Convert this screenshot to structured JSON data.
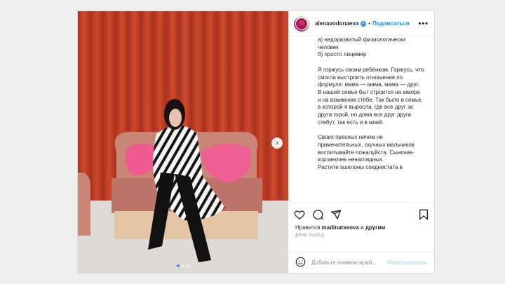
{
  "post": {
    "username": "alenavodonaeva",
    "separator": "•",
    "follow_label": "Подписаться",
    "more_label": "•••",
    "caption": "а) недоразвитый физиологически человек\nб) просто лицемер\n\nЯ горжусь своим ребёнком. Горжусь, что смогла выстроить отношения по формуле: мама — мама, мама — друг.\nВ нашей семье быт строится на юморе и на взаимном стёбе. Так было в семье, в которой я выросла, где все друг за друга горой, но дома все друг друга стебут, так есть и в моей.\n\nСвоих пресных ничем не примечательных, скучных мальчиков воспитывайте пожалуйста. Сыночек-корзиночек ненаглядных.\nРастите эшелоны соеднестата в",
    "likes_prefix": "Нравится ",
    "likes_user": "madinatseova",
    "likes_suffix": " и ",
    "likes_others": "другим",
    "time": "день назад",
    "comment_placeholder": "Добавьте комментарий...",
    "publish_label": "Опубликовать"
  },
  "carousel": {
    "next_icon": "chevron-right-icon",
    "dots": 3,
    "active_dot": 0
  },
  "colors": {
    "accent": "#0095f6",
    "publish_disabled": "#b2dffc",
    "curtain": "#c0402a",
    "sofa": "#c98576"
  },
  "icons": [
    "heart-icon",
    "comment-icon",
    "share-icon",
    "bookmark-icon",
    "emoji-icon",
    "more-icon",
    "verified-icon"
  ]
}
